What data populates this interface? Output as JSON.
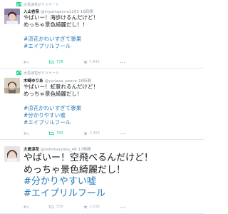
{
  "colors": {
    "link": "#2b7bb9",
    "retweet": "#19cf86",
    "muted": "#8899a6",
    "icon": "#aab8c2"
  },
  "tweets": [
    {
      "retweeted_by": "大島涼花がリツイート",
      "name": "入山杏奈",
      "handle": "@iriyamaanna1203",
      "time": "16時間",
      "lines": [
        "やばいー！海歩けるんだけど！",
        "めっちゃ景色綺麗だし！！"
      ],
      "tags": [
        "#涼花かわいすぎて褒果",
        "#エイプリルフール"
      ],
      "retweets": "778",
      "likes": "3,843"
    },
    {
      "retweeted_by": "大島涼花がリツイート",
      "name": "木崎ゆりあ",
      "handle": "@yuriaaa_peace",
      "time": "16時間",
      "lines": [
        "やばいー！虹登れるんだけど！",
        "めっちゃ景色綺麗だし！"
      ],
      "tags": [
        "#涼花かわいすぎて褒果",
        "#分かりやすい嘘",
        "#エイプリルフール"
      ],
      "retweets": "793",
      "likes": "3,453"
    },
    {
      "name": "大島涼花",
      "handle": "@oshimaryoka_48",
      "time": "17時間",
      "lines": [
        "やばいー！空飛べるんだけど！",
        "めっちゃ景色綺麗だし！"
      ],
      "tags": [
        "#分かりやすい嘘",
        "#エイプリルフール"
      ],
      "retweets": "539",
      "likes": "2,016"
    }
  ]
}
